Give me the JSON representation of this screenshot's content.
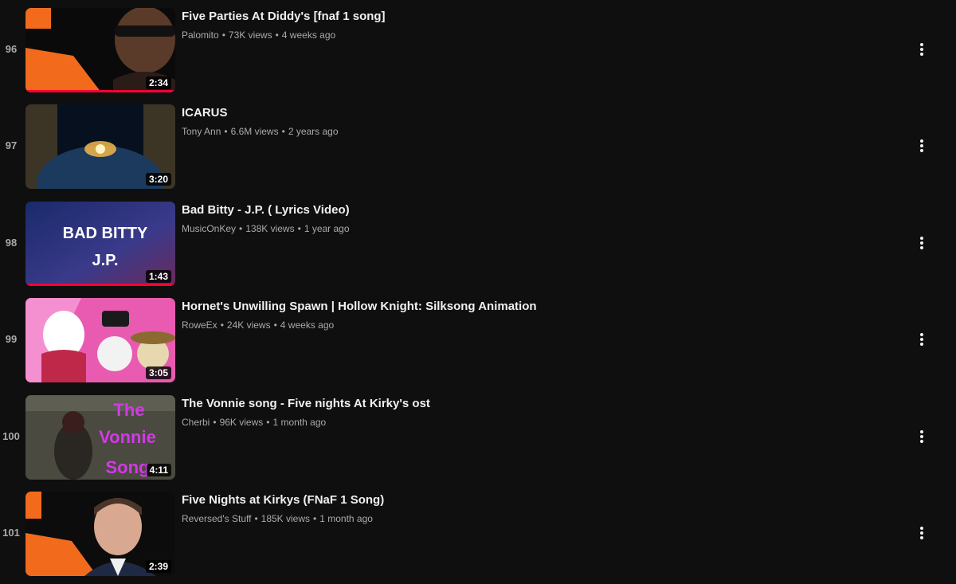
{
  "playlist": {
    "items": [
      {
        "index": "96",
        "title": "Five Parties At Diddy's [fnaf 1 song]",
        "channel": "Palomito",
        "views": "73K views",
        "age": "4 weeks ago",
        "duration": "2:34",
        "watched_fraction": 1.0
      },
      {
        "index": "97",
        "title": "ICARUS",
        "channel": "Tony Ann",
        "views": "6.6M views",
        "age": "2 years ago",
        "duration": "3:20",
        "watched_fraction": 0
      },
      {
        "index": "98",
        "title": "Bad Bitty - J.P. ( Lyrics Video)",
        "channel": "MusicOnKey",
        "views": "138K views",
        "age": "1 year ago",
        "duration": "1:43",
        "watched_fraction": 1.0,
        "thumb_text": [
          "BAD BITTY",
          "J.P."
        ]
      },
      {
        "index": "99",
        "title": "Hornet's Unwilling Spawn | Hollow Knight: Silksong Animation",
        "channel": "RoweEx",
        "views": "24K views",
        "age": "4 weeks ago",
        "duration": "3:05",
        "watched_fraction": 0
      },
      {
        "index": "100",
        "title": "The Vonnie song - Five nights At Kirky's ost",
        "channel": "Cherbi",
        "views": "96K views",
        "age": "1 month ago",
        "duration": "4:11",
        "watched_fraction": 0,
        "thumb_text": [
          "The",
          "Vonnie",
          "Song"
        ]
      },
      {
        "index": "101",
        "title": "Five Nights at Kirkys (FNaF 1 Song)",
        "channel": "Reversed's Stuff",
        "views": "185K views",
        "age": "1 month ago",
        "duration": "2:39",
        "watched_fraction": 0
      }
    ]
  },
  "colors": {
    "background": "#0f0f0f",
    "title_text": "#f1f1f1",
    "secondary_text": "#aaaaaa",
    "progress": "#ff0033",
    "logo_orange": "#f26b1d"
  },
  "icons": {
    "menu": "more-vert-icon"
  }
}
